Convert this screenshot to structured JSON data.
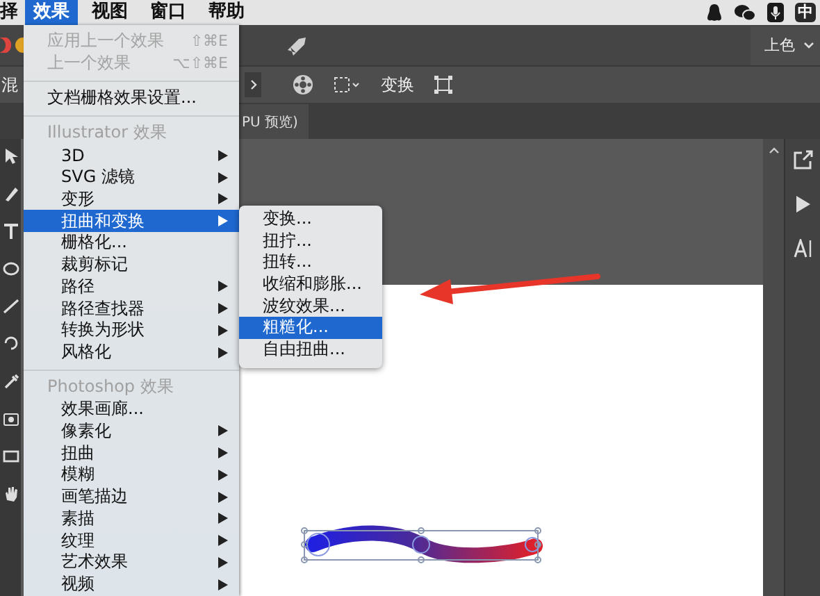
{
  "menu_bar": {
    "items": [
      {
        "label": "择",
        "selected": false
      },
      {
        "label": "效果",
        "selected": true
      },
      {
        "label": "视图",
        "selected": false
      },
      {
        "label": "窗口",
        "selected": false
      },
      {
        "label": "帮助",
        "selected": false
      }
    ],
    "ime": "中"
  },
  "title_bar": {
    "workspace": "上色"
  },
  "control_bar": {
    "label": "混",
    "transform": "变换"
  },
  "document_tab": {
    "title": "PU 预览)"
  },
  "effect_menu": {
    "items": [
      {
        "kind": "item",
        "label": "应用上一个效果",
        "shortcut": "⇧⌘E",
        "disabled": true,
        "submenu": false,
        "selected": false
      },
      {
        "kind": "item",
        "label": "上一个效果",
        "shortcut": "⌥⇧⌘E",
        "disabled": true,
        "submenu": false,
        "selected": false
      },
      {
        "kind": "separator"
      },
      {
        "kind": "item",
        "label": "文档栅格效果设置...",
        "disabled": false,
        "submenu": false,
        "selected": false
      },
      {
        "kind": "separator"
      },
      {
        "kind": "group",
        "label": "Illustrator 效果",
        "children": [
          {
            "kind": "item",
            "label": "3D",
            "disabled": false,
            "submenu": true,
            "selected": false
          },
          {
            "kind": "item",
            "label": "SVG 滤镜",
            "disabled": false,
            "submenu": true,
            "selected": false
          },
          {
            "kind": "item",
            "label": "变形",
            "disabled": false,
            "submenu": true,
            "selected": false
          },
          {
            "kind": "item",
            "label": "扭曲和变换",
            "disabled": false,
            "submenu": true,
            "selected": true
          },
          {
            "kind": "item",
            "label": "栅格化...",
            "disabled": false,
            "submenu": false,
            "selected": false
          },
          {
            "kind": "item",
            "label": "裁剪标记",
            "disabled": false,
            "submenu": false,
            "selected": false
          },
          {
            "kind": "item",
            "label": "路径",
            "disabled": false,
            "submenu": true,
            "selected": false
          },
          {
            "kind": "item",
            "label": "路径查找器",
            "disabled": false,
            "submenu": true,
            "selected": false
          },
          {
            "kind": "item",
            "label": "转换为形状",
            "disabled": false,
            "submenu": true,
            "selected": false
          },
          {
            "kind": "item",
            "label": "风格化",
            "disabled": false,
            "submenu": true,
            "selected": false
          }
        ]
      },
      {
        "kind": "separator"
      },
      {
        "kind": "group",
        "label": "Photoshop 效果",
        "children": [
          {
            "kind": "item",
            "label": "效果画廊...",
            "disabled": false,
            "submenu": false,
            "selected": false
          },
          {
            "kind": "item",
            "label": "像素化",
            "disabled": false,
            "submenu": true,
            "selected": false
          },
          {
            "kind": "item",
            "label": "扭曲",
            "disabled": false,
            "submenu": true,
            "selected": false
          },
          {
            "kind": "item",
            "label": "模糊",
            "disabled": false,
            "submenu": true,
            "selected": false
          },
          {
            "kind": "item",
            "label": "画笔描边",
            "disabled": false,
            "submenu": true,
            "selected": false
          },
          {
            "kind": "item",
            "label": "素描",
            "disabled": false,
            "submenu": true,
            "selected": false
          },
          {
            "kind": "item",
            "label": "纹理",
            "disabled": false,
            "submenu": true,
            "selected": false
          },
          {
            "kind": "item",
            "label": "艺术效果",
            "disabled": false,
            "submenu": true,
            "selected": false
          },
          {
            "kind": "item",
            "label": "视频",
            "disabled": false,
            "submenu": true,
            "selected": false
          }
        ]
      }
    ]
  },
  "submenu": {
    "items": [
      {
        "label": "变换...",
        "selected": false
      },
      {
        "label": "扭拧...",
        "selected": false
      },
      {
        "label": "扭转...",
        "selected": false
      },
      {
        "label": "收缩和膨胀...",
        "selected": false
      },
      {
        "label": "波纹效果...",
        "selected": false
      },
      {
        "label": "粗糙化...",
        "selected": true
      },
      {
        "label": "自由扭曲...",
        "selected": false
      }
    ]
  }
}
